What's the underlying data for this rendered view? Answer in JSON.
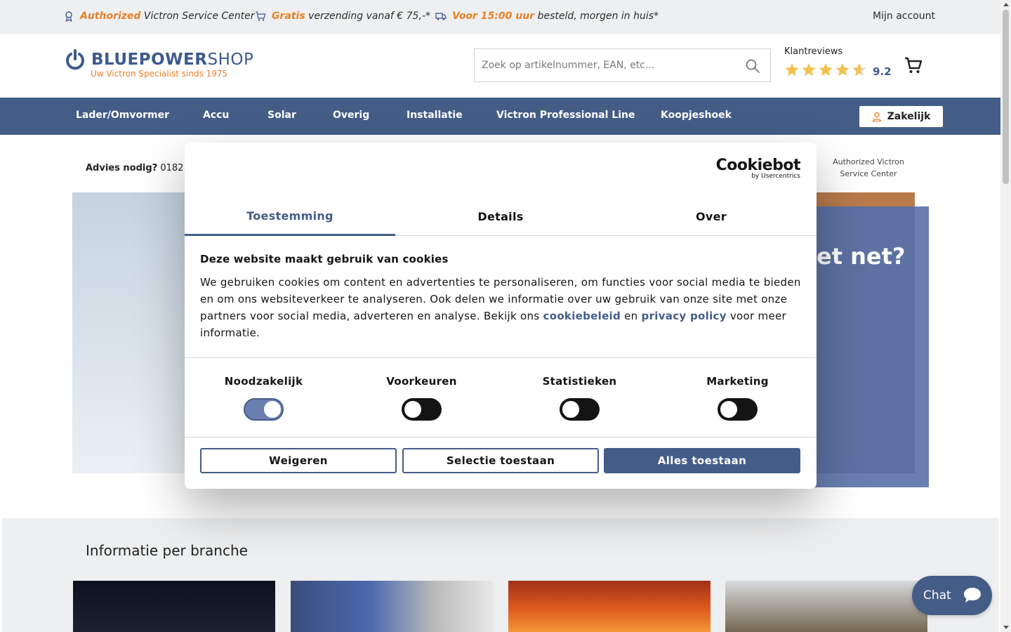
{
  "topbar": {
    "usp1_highlight": "Authorized",
    "usp1_text": "Victron Service Center",
    "usp2_highlight": "Gratis",
    "usp2_text": "verzending vanaf € 75,-*",
    "usp3_highlight": "Voor 15:00 uur",
    "usp3_text": "besteld, morgen in huis*",
    "account": "Mijn account"
  },
  "header": {
    "logo_bold": "BLUEPOWER",
    "logo_thin": "SHOP",
    "logo_tagline": "Uw Victron Specialist sinds 1975",
    "search_placeholder": "Zoek op artikelnummer, EAN, etc...",
    "reviews_label": "Klantreviews",
    "reviews_score": "9.2",
    "reviews_stars": 4.6
  },
  "nav": {
    "items": [
      "Lader/Omvormer",
      "Accu",
      "Solar",
      "Overig",
      "Installatie",
      "Victron Professional Line",
      "Koopjeshoek"
    ],
    "zakelijk": "Zakelijk"
  },
  "page": {
    "advies_label": "Advies nodig?",
    "advies_phone": "0182",
    "auth_badge": "Authorized Victron Service Center",
    "hero_title_partial": "et net?",
    "branche_title": "Informatie per branche"
  },
  "chat": {
    "label": "Chat"
  },
  "cookie": {
    "logo_main": "Cookiebot",
    "logo_sub": "by Usercentrics",
    "tabs": [
      "Toestemming",
      "Details",
      "Over"
    ],
    "heading": "Deze website maakt gebruik van cookies",
    "body_pre": "We gebruiken cookies om content en advertenties te personaliseren, om functies voor social media te bieden en om ons websiteverkeer te analyseren. Ook delen we informatie over uw gebruik van onze site met onze partners voor social media, adverteren en analyse. Bekijk ons",
    "link1": "cookiebeleid",
    "body_mid": "en",
    "link2": "privacy policy",
    "body_post": "voor meer informatie.",
    "toggles": [
      {
        "label": "Noodzakelijk",
        "on": true
      },
      {
        "label": "Voorkeuren",
        "on": false
      },
      {
        "label": "Statistieken",
        "on": false
      },
      {
        "label": "Marketing",
        "on": false
      }
    ],
    "btn_deny": "Weigeren",
    "btn_selection": "Selectie toestaan",
    "btn_all": "Alles toestaan"
  },
  "colors": {
    "brand": "#445d87",
    "accent": "#e88128"
  }
}
